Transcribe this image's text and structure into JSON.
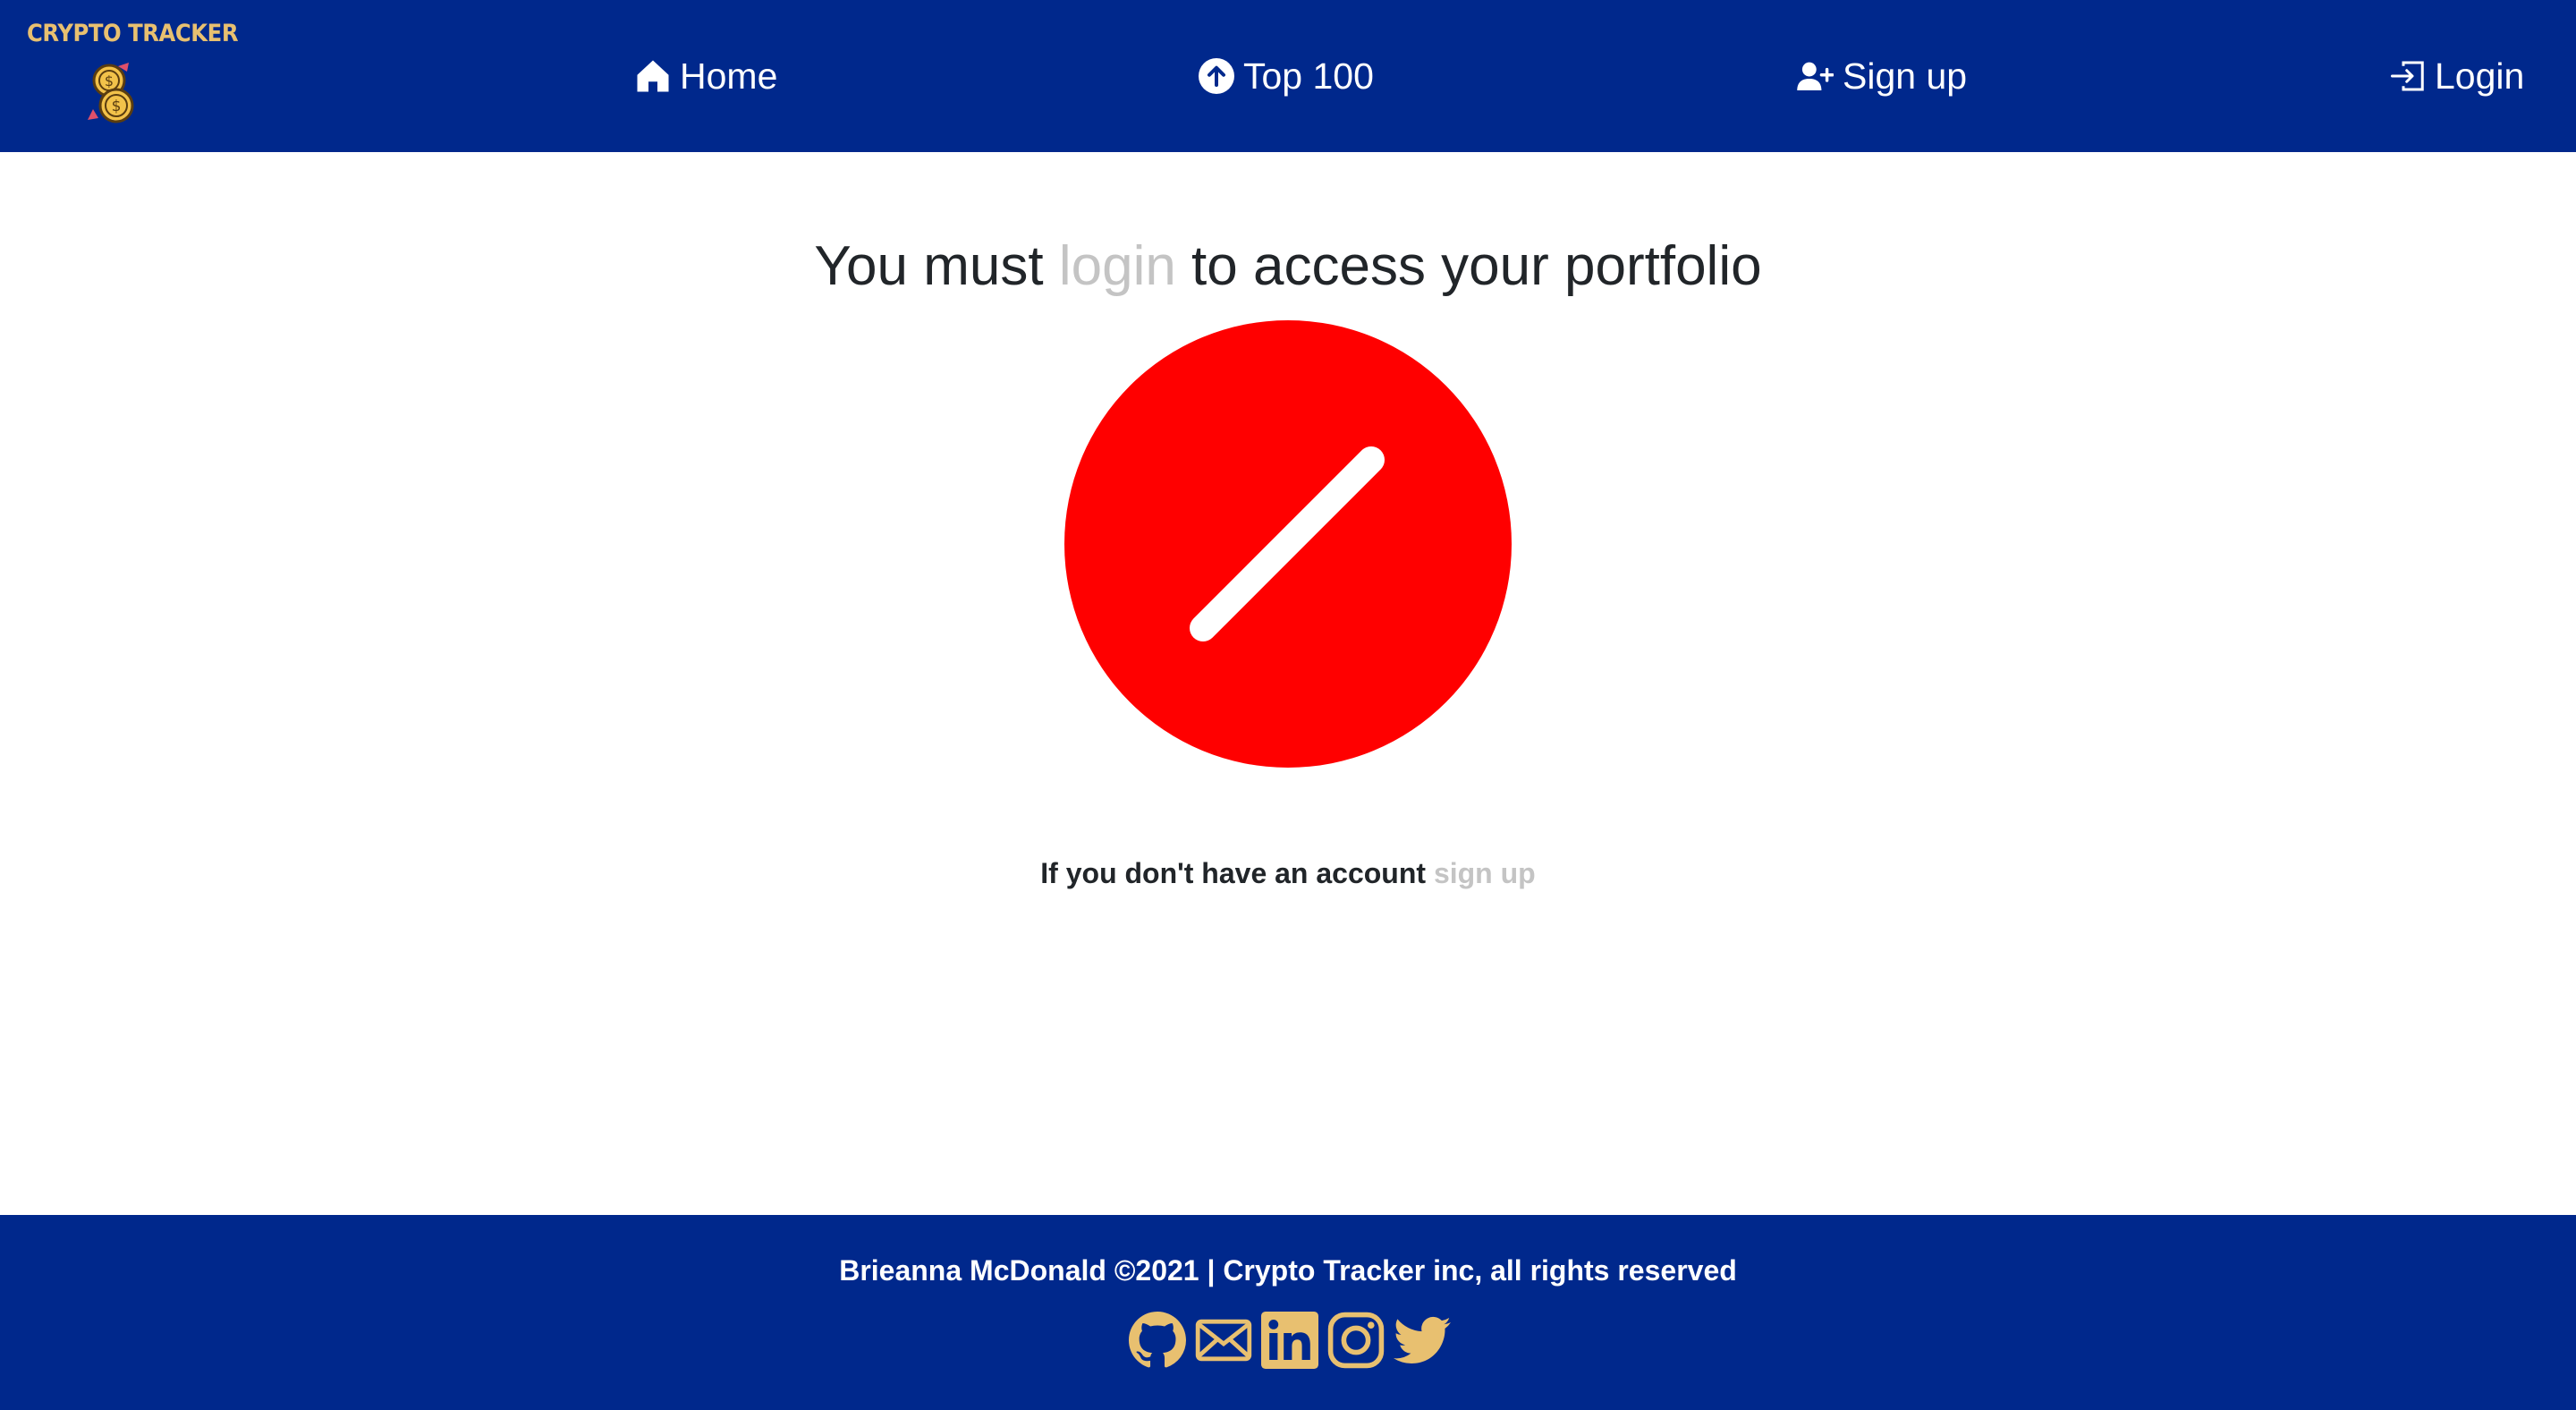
{
  "brand": {
    "name": "CRYPTO TRACKER",
    "logo_icon": "crypto-coins-icon",
    "logo_color": "#e8c070"
  },
  "nav": {
    "items": [
      {
        "label": "Home",
        "icon": "home-icon"
      },
      {
        "label": "Top 100",
        "icon": "arrow-up-circle-icon"
      },
      {
        "label": "Sign up",
        "icon": "person-plus-icon"
      },
      {
        "label": "Login",
        "icon": "box-arrow-in-right-icon"
      }
    ]
  },
  "main": {
    "title_prefix": "You must ",
    "title_link": "login",
    "title_suffix": " to access your portfolio",
    "forbidden_icon": "forbidden-sign-icon",
    "account_prefix": "If you don't have an account ",
    "account_link": "sign up"
  },
  "footer": {
    "text": "Brieanna McDonald ©2021 | Crypto Tracker inc, all rights reserved",
    "socials": [
      "github-icon",
      "envelope-icon",
      "linkedin-icon",
      "instagram-icon",
      "twitter-icon"
    ]
  },
  "colors": {
    "navbar": "#00288c",
    "accent": "#e8c070",
    "forbidden": "#ff0000",
    "muted_link": "#c4c4c4"
  }
}
